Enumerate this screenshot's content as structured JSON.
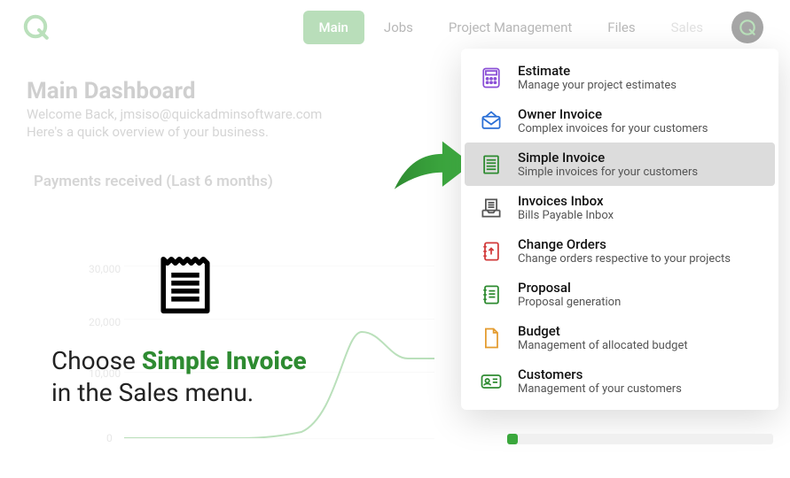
{
  "nav": {
    "main": "Main",
    "jobs": "Jobs",
    "pm": "Project Management",
    "files": "Files",
    "sales": "Sales"
  },
  "page": {
    "title": "Main Dashboard",
    "welcome": "Welcome Back, jmsiso@quickadminsoftware.com",
    "sub": "Here's a quick overview of your business.",
    "card_title": "Payments received (Last 6 months)"
  },
  "chart_data": {
    "type": "line",
    "ylim": [
      0,
      30000
    ],
    "yticks": [
      "30,000",
      "20,000",
      "10,000",
      "0"
    ],
    "values": [
      0,
      0,
      0,
      1000,
      18000,
      14000
    ]
  },
  "dropdown": {
    "items": [
      {
        "title": "Estimate",
        "sub": "Manage your project estimates"
      },
      {
        "title": "Owner Invoice",
        "sub": "Complex invoices for your customers"
      },
      {
        "title": "Simple Invoice",
        "sub": "Simple invoices for your customers"
      },
      {
        "title": "Invoices Inbox",
        "sub": "Bills Payable Inbox"
      },
      {
        "title": "Change Orders",
        "sub": "Change orders respective to your projects"
      },
      {
        "title": "Proposal",
        "sub": "Proposal generation"
      },
      {
        "title": "Budget",
        "sub": "Management of allocated budget"
      },
      {
        "title": "Customers",
        "sub": "Management of your customers"
      }
    ]
  },
  "instruction": {
    "pre": "Choose ",
    "hl": "Simple Invoice",
    "post": "in the Sales menu."
  }
}
